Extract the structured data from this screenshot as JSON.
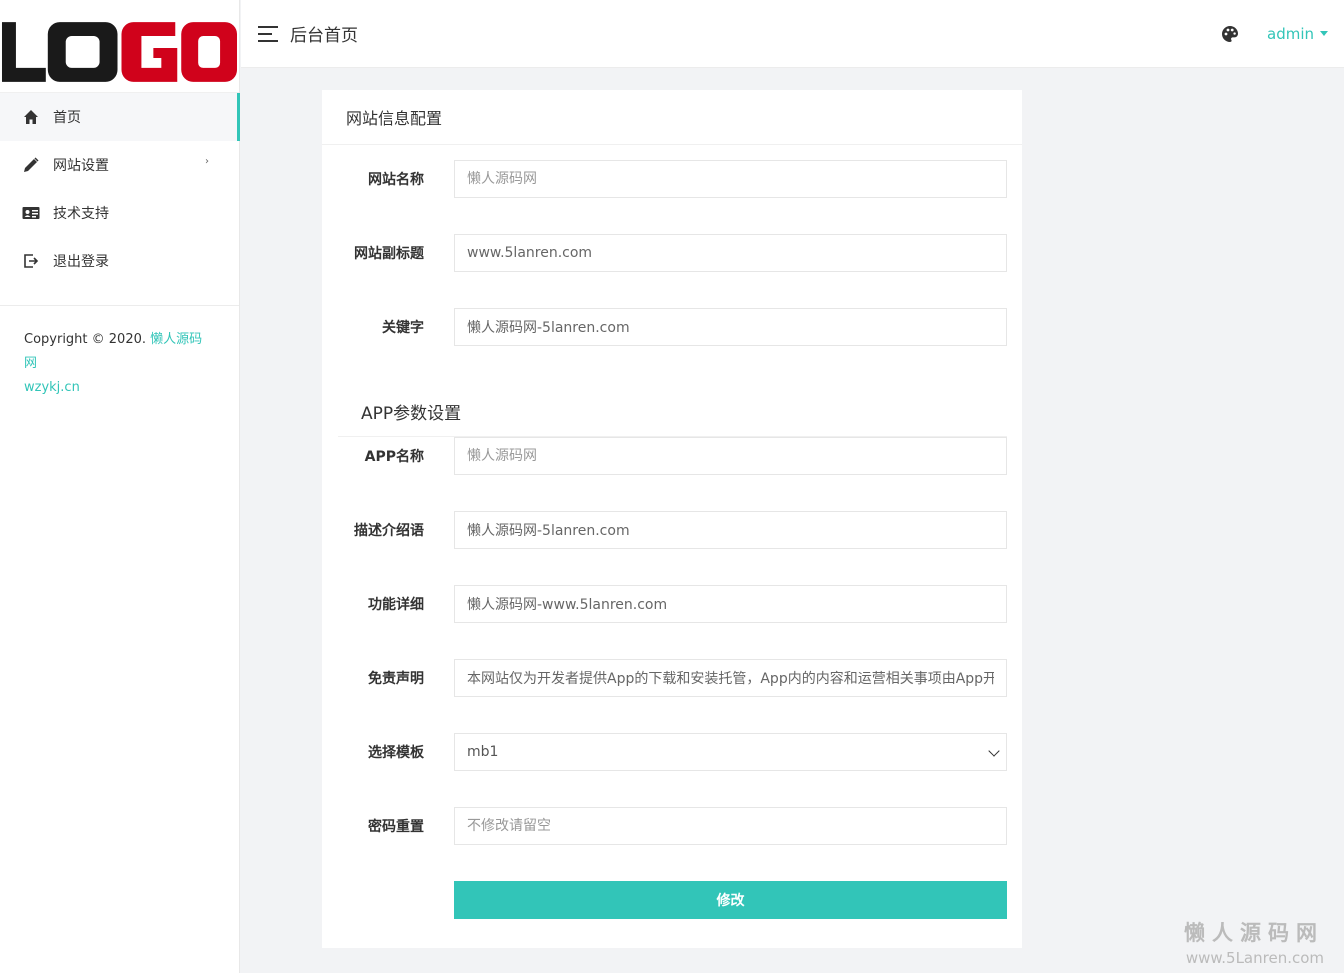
{
  "logo": {
    "text": "LOGO"
  },
  "sidebar": {
    "items": [
      {
        "label": "首页",
        "icon": "home-icon"
      },
      {
        "label": "网站设置",
        "icon": "pencil-icon"
      },
      {
        "label": "技术支持",
        "icon": "id-card-icon"
      },
      {
        "label": "退出登录",
        "icon": "logout-icon"
      }
    ],
    "copyright_prefix": "Copyright © 2020.",
    "copyright_link1": "懒人源码网",
    "copyright_link2": "wzykj.cn"
  },
  "topbar": {
    "title": "后台首页",
    "user": "admin"
  },
  "card": {
    "title": "网站信息配置",
    "section2_title": "APP参数设置",
    "fields": [
      {
        "label": "网站名称",
        "placeholder": "懒人源码网"
      },
      {
        "label": "网站副标题",
        "value": "www.5lanren.com"
      },
      {
        "label": "关键字",
        "value": "懒人源码网-5lanren.com"
      },
      {
        "label": "APP名称",
        "placeholder": "懒人源码网"
      },
      {
        "label": "描述介绍语",
        "value": "懒人源码网-5lanren.com"
      },
      {
        "label": "功能详细",
        "value": "懒人源码网-www.5lanren.com"
      },
      {
        "label": "免责声明",
        "value": "本网站仅为开发者提供App的下载和安装托管，App内的内容和运营相关事项由App开"
      },
      {
        "label": "选择模板",
        "selected": "mb1"
      },
      {
        "label": "密码重置",
        "placeholder": "不修改请留空"
      }
    ],
    "submit_label": "修改"
  },
  "watermark": {
    "cn": "懒人源码网",
    "en": "www.5Lanren.com"
  },
  "colors": {
    "accent": "#32c5b8",
    "logo_dark": "#1a1a1a",
    "logo_red": "#d0021b"
  }
}
